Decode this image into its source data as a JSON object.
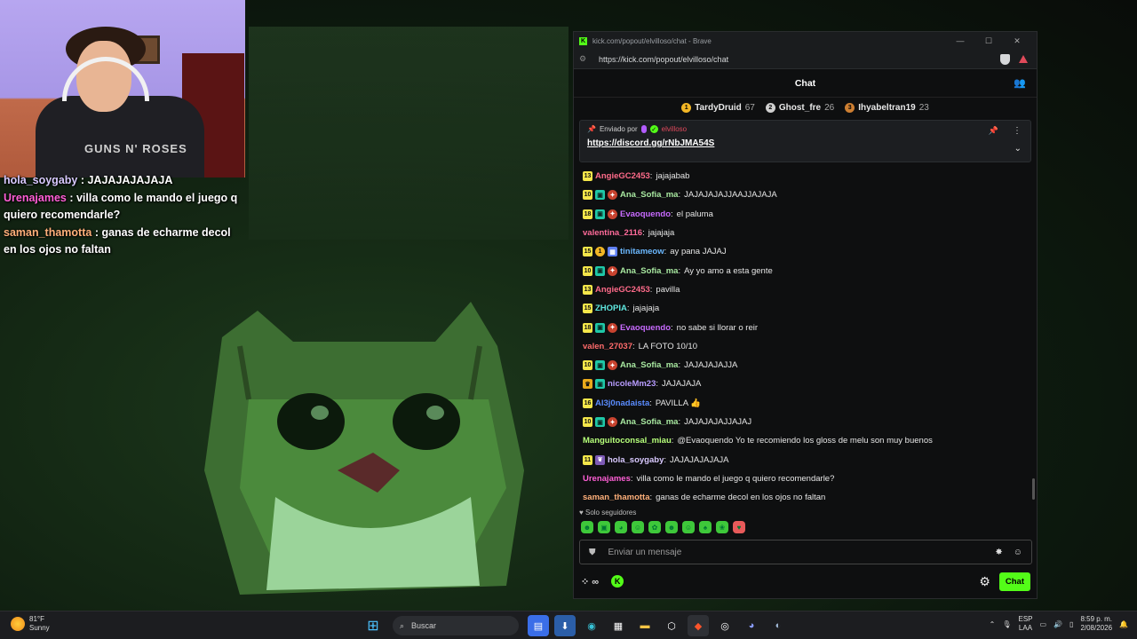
{
  "overlay_chat": [
    {
      "user": "hola_soygaby",
      "text": " : JAJAJAJAJAJA",
      "color": "#d9c9ff"
    },
    {
      "user": "Urenajames",
      "text": " : villa como le mando el juego q quiero recomendarle?",
      "color": "#ff5fd6"
    },
    {
      "user": "saman_thamotta",
      "text": " : ganas de echarme decol en los ojos no faltan",
      "color": "#ffb07a"
    }
  ],
  "browser": {
    "title": "kick.com/popout/elvilloso/chat - Brave",
    "url": "https://kick.com/popout/elvilloso/chat"
  },
  "chat": {
    "header": "Chat",
    "leaderboard": [
      {
        "rank": "1",
        "name": "TardyDruid",
        "count": "67",
        "color": "#f2b625"
      },
      {
        "rank": "2",
        "name": "Ghost_fre",
        "count": "26",
        "color": "#cfcfcf"
      },
      {
        "rank": "3",
        "name": "Ihyabeltran19",
        "count": "23",
        "color": "#cd7f32"
      }
    ],
    "pinned": {
      "label": "Enviado por",
      "sender": "elvilloso",
      "link": "https://discord.gg/rNbJMA54S"
    },
    "messages": [
      {
        "badges": [
          {
            "t": "sub",
            "v": "13"
          }
        ],
        "user": "AngieGC2453",
        "color": "#ff6b8a",
        "text": "jajajabab"
      },
      {
        "badges": [
          {
            "t": "sub",
            "v": "10"
          },
          {
            "t": "og",
            "v": "▣"
          },
          {
            "t": "gift",
            "v": "✦"
          }
        ],
        "user": "Ana_Sofia_ma",
        "color": "#a8e8a0",
        "text": "JAJAJAJAJJAAJJAJAJA"
      },
      {
        "badges": [
          {
            "t": "sub",
            "v": "18"
          },
          {
            "t": "og",
            "v": "▣"
          },
          {
            "t": "gift",
            "v": "✦"
          }
        ],
        "user": "Evaoquendo",
        "color": "#c86bff",
        "text": "el paluma"
      },
      {
        "badges": [],
        "user": "valentina_2116",
        "color": "#ff6b9a",
        "text": "jajajaja"
      },
      {
        "badges": [
          {
            "t": "sub",
            "v": "15"
          },
          {
            "t": "coin",
            "v": "1"
          },
          {
            "t": "mod",
            "v": "▦"
          }
        ],
        "user": "tinitameow",
        "color": "#6bb8ff",
        "text": "ay pana JAJAJ"
      },
      {
        "badges": [
          {
            "t": "sub",
            "v": "10"
          },
          {
            "t": "og",
            "v": "▣"
          },
          {
            "t": "gift",
            "v": "✦"
          }
        ],
        "user": "Ana_Sofia_ma",
        "color": "#a8e8a0",
        "text": "Ay yo amo a esta gente"
      },
      {
        "badges": [
          {
            "t": "sub",
            "v": "13"
          }
        ],
        "user": "AngieGC2453",
        "color": "#ff6b8a",
        "text": "pavilla"
      },
      {
        "badges": [
          {
            "t": "sub",
            "v": "15"
          }
        ],
        "user": "ZHOPIA",
        "color": "#5fe8e0",
        "text": "jajajaja"
      },
      {
        "badges": [
          {
            "t": "sub",
            "v": "18"
          },
          {
            "t": "og",
            "v": "▣"
          },
          {
            "t": "gift",
            "v": "✦"
          }
        ],
        "user": "Evaoquendo",
        "color": "#c86bff",
        "text": "no sabe si llorar o reir"
      },
      {
        "badges": [],
        "user": "valen_27037",
        "color": "#ff6b6b",
        "text": "LA FOTO 10/10"
      },
      {
        "badges": [
          {
            "t": "sub",
            "v": "10"
          },
          {
            "t": "og",
            "v": "▣"
          },
          {
            "t": "gift",
            "v": "✦"
          }
        ],
        "user": "Ana_Sofia_ma",
        "color": "#a8e8a0",
        "text": "JAJAJAJAJJA"
      },
      {
        "badges": [
          {
            "t": "vip",
            "v": "♛"
          },
          {
            "t": "og",
            "v": "▣"
          }
        ],
        "user": "nicoleMm23",
        "color": "#b89cff",
        "text": "JAJAJAJA"
      },
      {
        "badges": [
          {
            "t": "sub",
            "v": "16"
          }
        ],
        "user": "Al3j0nadaista",
        "color": "#5a8cff",
        "text": "PAVILLA 👍"
      },
      {
        "badges": [
          {
            "t": "sub",
            "v": "10"
          },
          {
            "t": "og",
            "v": "▣"
          },
          {
            "t": "gift",
            "v": "✦"
          }
        ],
        "user": "Ana_Sofia_ma",
        "color": "#a8e8a0",
        "text": "JAJAJAJAJJAJAJ"
      },
      {
        "badges": [],
        "user": "Manguitoconsal_miau",
        "color": "#b6ff7a",
        "text": "@Evaoquendo Yo te recomiendo los gloss de melu son muy buenos"
      },
      {
        "badges": [
          {
            "t": "sub",
            "v": "11"
          },
          {
            "t": "pup",
            "v": "❦"
          }
        ],
        "user": "hola_soygaby",
        "color": "#d9c9ff",
        "text": "JAJAJAJAJAJA"
      },
      {
        "badges": [],
        "user": "Urenajames",
        "color": "#ff5fd6",
        "text": "villa como le mando el juego q quiero recomendarle?"
      },
      {
        "badges": [],
        "user": "saman_thamotta",
        "color": "#ffb07a",
        "text": "ganas de echarme decol en los ojos no faltan"
      }
    ],
    "followers_only": "Solo seguidores",
    "emotes": [
      "emote-1",
      "emote-2",
      "emote-3",
      "emote-4",
      "emote-5",
      "emote-6",
      "emote-7",
      "emote-8",
      "emote-9",
      "emote-10"
    ],
    "input_placeholder": "Enviar un mensaje",
    "points": "∞",
    "send_label": "Chat"
  },
  "taskbar": {
    "temp": "81°F",
    "weather": "Sunny",
    "search_placeholder": "Buscar",
    "lang1": "ESP",
    "lang2": "LAA",
    "time": "8:59 p. m.",
    "date": "2/08/2026"
  },
  "colors": {
    "kick_green": "#53fc18"
  }
}
